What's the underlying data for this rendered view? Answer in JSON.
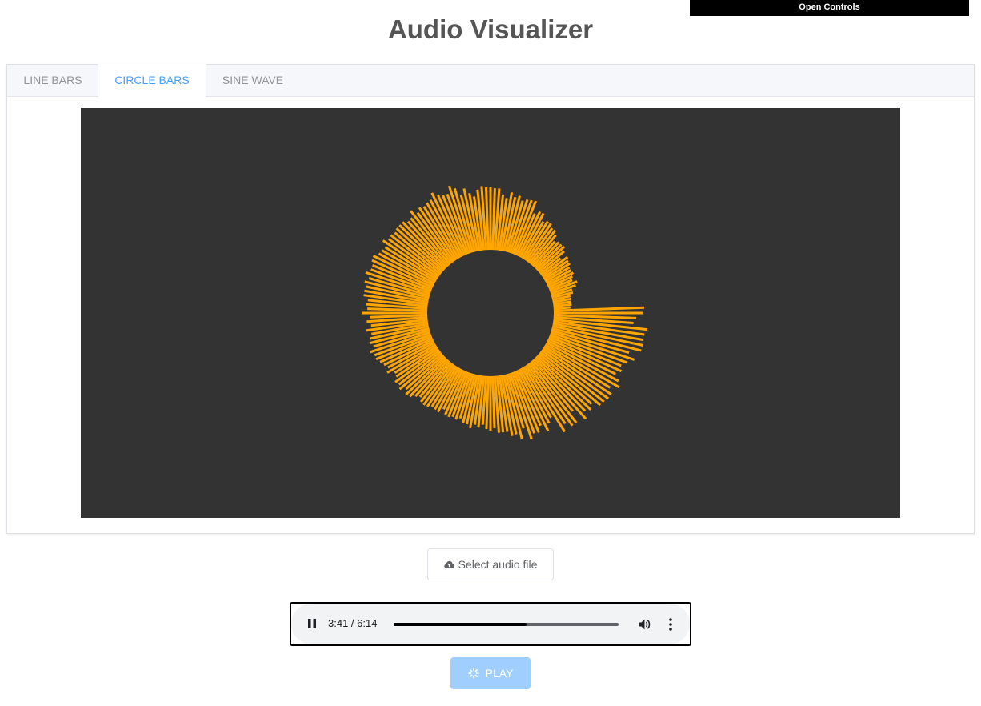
{
  "top_bar": {
    "open_controls_label": "Open Controls"
  },
  "header": {
    "title": "Audio Visualizer"
  },
  "tabs": [
    {
      "label": "LINE BARS",
      "active": false
    },
    {
      "label": "CIRCLE BARS",
      "active": true
    },
    {
      "label": "SINE WAVE",
      "active": false
    }
  ],
  "visualizer": {
    "background_color": "#333333",
    "bar_color": "#ffa500",
    "bar_count": 180,
    "bar_lengths": [
      113,
      104,
      101,
      119,
      116,
      116,
      117,
      116,
      102,
      111,
      104,
      98,
      101,
      96,
      103,
      108,
      98,
      104,
      104,
      102,
      101,
      92,
      96,
      92,
      100,
      82,
      96,
      96,
      89,
      97,
      73,
      78,
      86,
      76,
      83,
      82,
      88,
      72,
      84,
      77,
      78,
      72,
      72,
      72,
      66,
      70,
      67,
      62,
      66,
      63,
      68,
      64,
      64,
      59,
      62,
      60,
      62,
      61,
      56,
      62,
      61,
      60,
      63,
      64,
      63,
      59,
      62,
      67,
      69,
      64,
      70,
      67,
      69,
      64,
      63,
      71,
      67,
      70,
      73,
      76,
      76,
      80,
      74,
      77,
      76,
      73,
      79,
      72,
      77,
      73,
      83,
      76,
      78,
      76,
      82,
      82,
      81,
      84,
      80,
      86,
      81,
      81,
      84,
      85,
      80,
      79,
      77,
      84,
      79,
      80,
      78,
      80,
      80,
      80,
      76,
      77,
      84,
      77,
      81,
      79,
      81,
      82,
      89,
      83,
      81,
      80,
      89,
      84,
      74,
      81,
      74,
      69,
      77,
      81,
      79,
      79,
      78,
      78,
      71,
      67,
      75,
      70,
      73,
      68,
      71,
      72,
      73,
      58,
      63,
      63,
      54,
      57,
      57,
      53,
      53,
      49,
      42,
      45,
      45,
      46,
      42,
      33,
      41,
      39,
      39,
      36,
      36,
      37,
      34,
      32,
      37,
      34,
      28,
      28,
      24,
      24,
      24,
      24,
      22,
      114
    ]
  },
  "file_select": {
    "label": "Select audio file",
    "icon": "cloud-upload-icon"
  },
  "player": {
    "time_display": "3:41 / 6:14",
    "progress_fraction": 0.59
  },
  "play_button": {
    "label": "PLAY",
    "icon": "loading-icon",
    "disabled": true
  }
}
